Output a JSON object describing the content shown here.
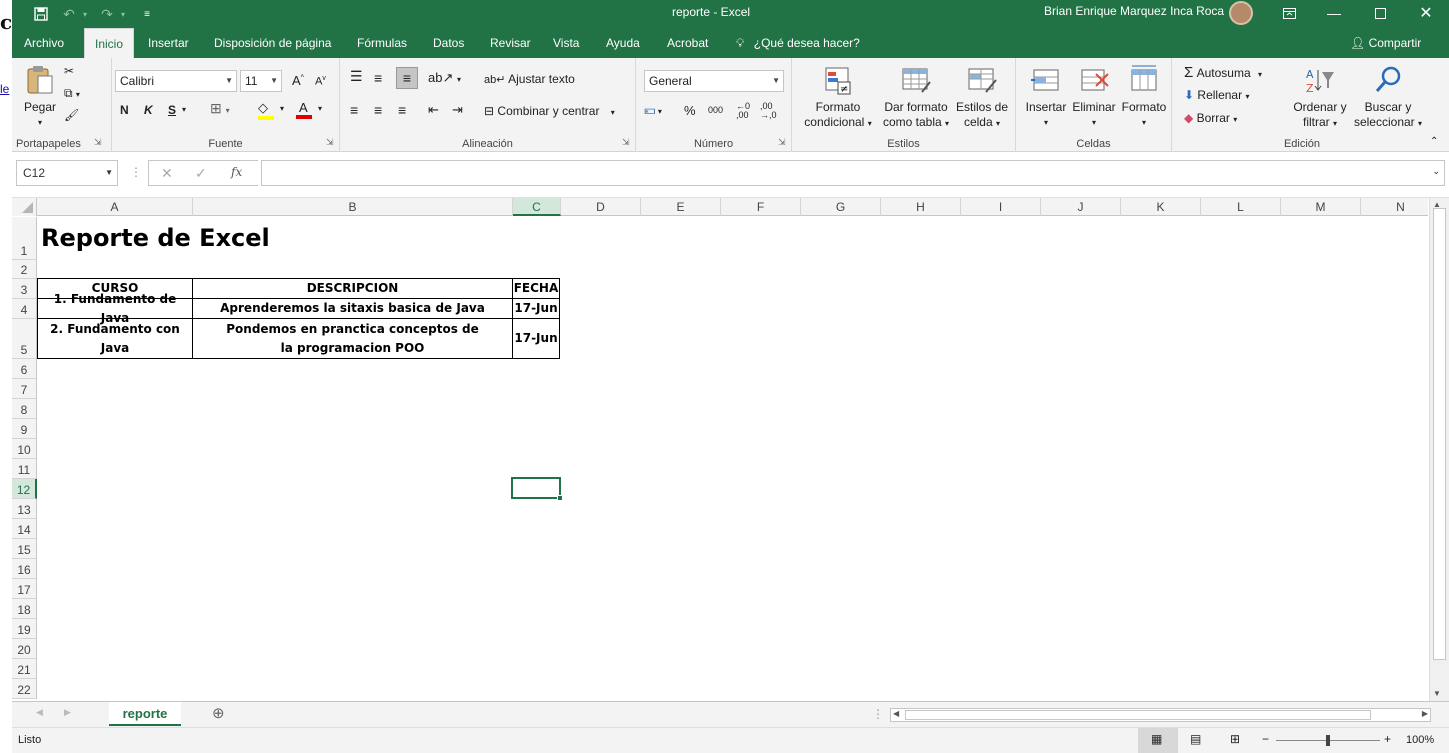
{
  "background": {
    "char": "c",
    "link": "le"
  },
  "titlebar": {
    "title": "reporte  -  Excel",
    "user": "Brian Enrique Marquez Inca Roca"
  },
  "tabs": [
    "Archivo",
    "Inicio",
    "Insertar",
    "Disposición de página",
    "Fórmulas",
    "Datos",
    "Revisar",
    "Vista",
    "Ayuda",
    "Acrobat"
  ],
  "tell_me": "¿Qué desea hacer?",
  "share": "Compartir",
  "ribbon": {
    "clipboard": {
      "paste": "Pegar",
      "label": "Portapapeles"
    },
    "font": {
      "name": "Calibri",
      "size": "11",
      "bold": "N",
      "italic": "K",
      "underline": "S",
      "label": "Fuente"
    },
    "alignment": {
      "wrap": "Ajustar texto",
      "merge": "Combinar y centrar",
      "label": "Alineación"
    },
    "number": {
      "format": "General",
      "percent": "%",
      "thousands": "000",
      "label": "Número"
    },
    "styles": {
      "conditional": [
        "Formato",
        "condicional"
      ],
      "table": [
        "Dar formato",
        "como tabla"
      ],
      "cell": [
        "Estilos de",
        "celda"
      ],
      "label": "Estilos"
    },
    "cells": {
      "insert": "Insertar",
      "delete": "Eliminar",
      "format": "Formato",
      "label": "Celdas"
    },
    "editing": {
      "autosum": "Autosuma",
      "fill": "Rellenar",
      "clear": "Borrar",
      "sort": [
        "Ordenar y",
        "filtrar"
      ],
      "find": [
        "Buscar y",
        "seleccionar"
      ],
      "label": "Edición"
    }
  },
  "namebox": "C12",
  "formula_icon": "fx",
  "columns": [
    "A",
    "B",
    "C",
    "D",
    "E",
    "F",
    "G",
    "H",
    "I",
    "J",
    "K",
    "L",
    "M",
    "N"
  ],
  "rows": [
    "1",
    "2",
    "3",
    "4",
    "5",
    "6",
    "7",
    "8",
    "9",
    "10",
    "11",
    "12",
    "13",
    "14",
    "15",
    "16",
    "17",
    "18",
    "19",
    "20",
    "21",
    "22"
  ],
  "sheet": {
    "title": "Reporte de Excel",
    "headers": [
      "CURSO",
      "DESCRIPCION",
      "FECHA"
    ],
    "rows": [
      [
        "1. Fundamento de Java",
        "Aprenderemos la sitaxis basica de Java",
        "17-Jun"
      ],
      [
        "2. Fundamento con Java",
        "Pondemos en pranctica conceptos de la programacion POO",
        "17-Jun"
      ]
    ]
  },
  "sheet_tab": "reporte",
  "status": {
    "ready": "Listo",
    "zoom": "100%"
  },
  "colors": {
    "accent": "#217346",
    "selection_header": "#d3e8da"
  }
}
